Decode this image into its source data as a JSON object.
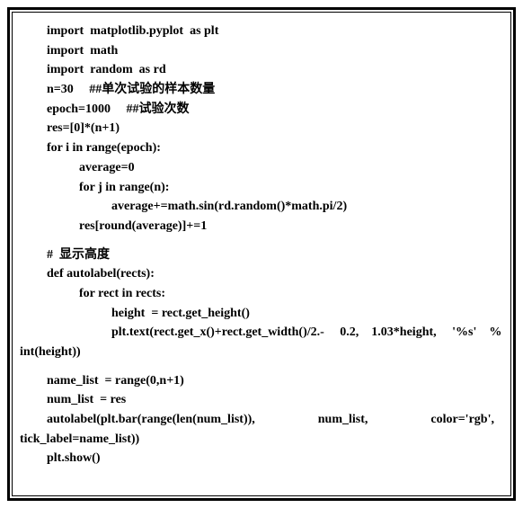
{
  "code": {
    "line1": "import  matplotlib.pyplot  as plt",
    "line2": "import  math",
    "line3": "import  random  as rd",
    "line4": "n=30     ##单次试验的样本数量",
    "line5": "epoch=1000     ##试验次数",
    "line6": "res=[0]*(n+1)",
    "line7": "for i in range(epoch):",
    "line8": "average=0",
    "line9": "for j in range(n):",
    "line10": "average+=math.sin(rd.random()*math.pi/2)",
    "line11": "res[round(average)]+=1",
    "line12": "#  显示高度",
    "line13": "def autolabel(rects):",
    "line14": "for rect in rects:",
    "line15": "height  = rect.get_height()",
    "line16": "plt.text(rect.get_x()+rect.get_width()/2.-     0.2,    1.03*height,     '%s'    %",
    "line17": "int(height))",
    "line18": "name_list  = range(0,n+1)",
    "line19": "num_list  = res",
    "line20": "autolabel(plt.bar(range(len(num_list)),                    num_list,                    color='rgb',",
    "line21": "tick_label=name_list))",
    "line22": "plt.show()"
  }
}
